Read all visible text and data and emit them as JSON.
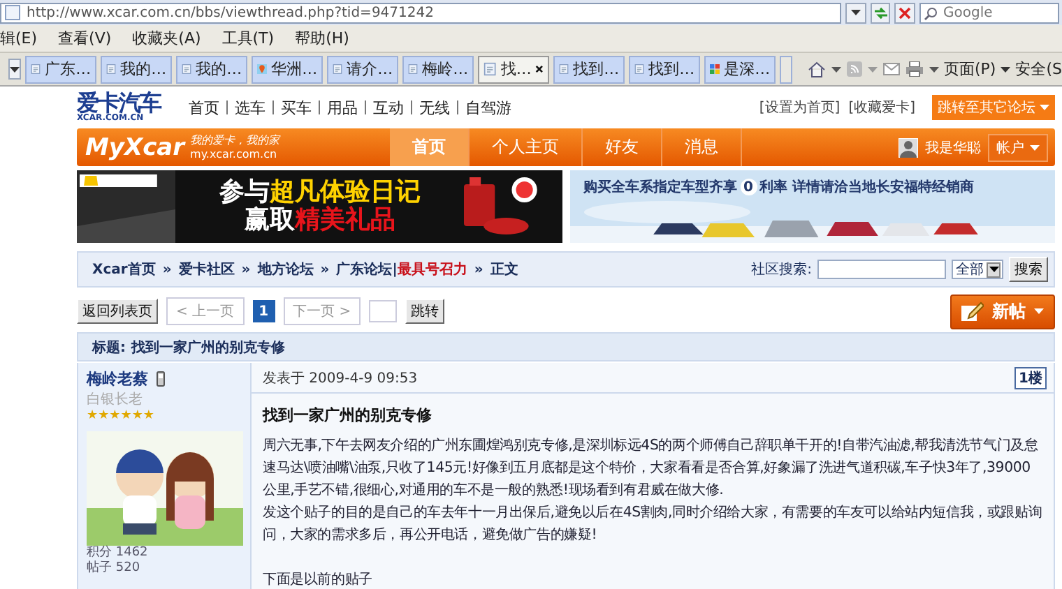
{
  "address_bar": {
    "url": "http://www.xcar.com.cn/bbs/viewthread.php?tid=9471242"
  },
  "search_box": {
    "placeholder": "Google"
  },
  "menu_bar": [
    "辑(E)",
    "查看(V)",
    "收藏夹(A)",
    "工具(T)",
    "帮助(H)"
  ],
  "tabs": [
    {
      "label": "广东…",
      "kind": "page",
      "selected": false
    },
    {
      "label": "我的…",
      "kind": "page",
      "selected": false
    },
    {
      "label": "我的…",
      "kind": "page",
      "selected": false
    },
    {
      "label": "华洲…",
      "kind": "map",
      "selected": false
    },
    {
      "label": "请介…",
      "kind": "page",
      "selected": false
    },
    {
      "label": "梅岭…",
      "kind": "page",
      "selected": false
    },
    {
      "label": "找…",
      "kind": "page",
      "selected": true
    },
    {
      "label": "找到…",
      "kind": "page",
      "selected": false
    },
    {
      "label": "找到…",
      "kind": "page",
      "selected": false
    },
    {
      "label": "是深…",
      "kind": "google",
      "selected": false
    }
  ],
  "command_bar": [
    "页面(P)",
    "安全(S"
  ],
  "site_header": {
    "logo": "爱卡汽车",
    "logo_sub": "XCAR.COM.CN",
    "nav": [
      "首页",
      "选车",
      "买车",
      "用品",
      "互动",
      "无线",
      "自驾游"
    ],
    "links": [
      "[设置为首页]",
      "[收藏爱卡]"
    ],
    "jump_button": "跳转至其它论坛"
  },
  "my_bar": {
    "logo": "MyXcar",
    "slogan": "我的爱卡，我的家",
    "domain": "my.xcar.com.cn",
    "tabs": [
      {
        "label": "首页",
        "selected": true
      },
      {
        "label": "个人主页",
        "selected": false
      },
      {
        "label": "好友",
        "selected": false
      },
      {
        "label": "消息",
        "selected": false
      }
    ],
    "user": "我是华聪",
    "account_menu": "帐户"
  },
  "ad_left": {
    "lines": [
      [
        {
          "text": "参与",
          "kind": "plain"
        },
        {
          "text": "超凡体验日记",
          "kind": "yellow"
        }
      ],
      [
        {
          "text": "赢取",
          "kind": "plain"
        },
        {
          "text": "精美礼品",
          "kind": "red"
        }
      ]
    ]
  },
  "ad_right": {
    "text": "购买全车系指定车型齐享",
    "rate": "0",
    "text_after": "利率  详情请洽当地长安福特经销商"
  },
  "breadcrumb": [
    {
      "kind": "link",
      "text": "Xcar首页"
    },
    {
      "kind": "separator",
      "text": "»"
    },
    {
      "kind": "link",
      "text": "爱卡社区"
    },
    {
      "kind": "separator",
      "text": "»"
    },
    {
      "kind": "link",
      "text": "地方论坛"
    },
    {
      "kind": "separator",
      "text": "»"
    },
    {
      "kind": "link",
      "text": "广东论坛|"
    },
    {
      "kind": "highlight",
      "text": "最具号召力"
    },
    {
      "kind": "separator",
      "text": "»"
    },
    {
      "kind": "current",
      "text": "正文"
    }
  ],
  "community_search": {
    "label": "社区搜索:",
    "scope": "全部",
    "button": "搜索"
  },
  "pagination": {
    "back": "返回列表页",
    "prev": {
      "label": "< 上一页",
      "disabled": true
    },
    "pages": [
      {
        "label": "1",
        "selected": true
      }
    ],
    "next": {
      "label": "下一页 >",
      "disabled": true
    },
    "jump": "跳转"
  },
  "new_post_button": "新帖",
  "thread_title": {
    "label": "标题:",
    "title": "找到一家广州的别克专修"
  },
  "post": {
    "author": "梅岭老蔡",
    "rank": "白银长老",
    "stars": 6,
    "stats": [
      "积分 1462",
      "帖子 520"
    ],
    "posted": "发表于 2009-4-9 09:53",
    "floor": "1楼",
    "title": "找到一家广州的别克专修",
    "paragraphs": [
      "周六无事,下午去网友介绍的广州东圃煌鸿别克专修,是深圳标远4S的两个师傅自己辞职单干开的!自带汽油滤,帮我清洗节气门及怠速马达\\喷油嘴\\油泵,只收了145元!好像到五月底都是这个特价，大家看看是否合算,好象漏了洗进气道积碳,车子快3年了,39000公里,手艺不错,很细心,对通用的车不是一般的熟悉!现场看到有君威在做大修.",
      "发这个贴子的目的是自己的车去年十一月出保后,避免以后在4S割肉,同时介绍给大家，有需要的车友可以给站内短信我，或跟贴询问，大家的需求多后，再公开电话，避免做广告的嫌疑!",
      "下面是以前的贴子"
    ]
  }
}
